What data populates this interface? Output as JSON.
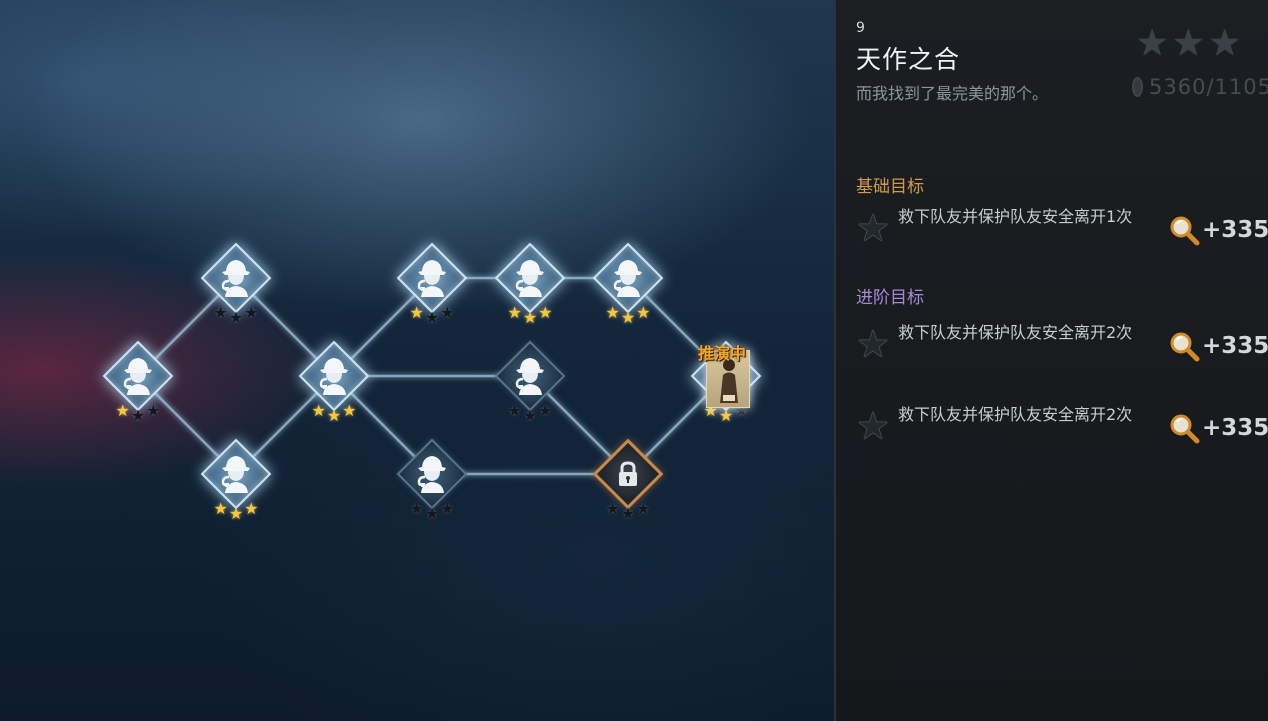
{
  "stage_map": {
    "nodes": [
      {
        "id": "a1",
        "state": "cleared",
        "stars": 1,
        "icon": "detective-icon"
      },
      {
        "id": "a2",
        "state": "cleared",
        "stars": 0,
        "icon": "detective-icon"
      },
      {
        "id": "a3",
        "state": "cleared",
        "stars": 3,
        "icon": "detective-icon"
      },
      {
        "id": "b1",
        "state": "cleared",
        "stars": 2,
        "icon": "detective-icon"
      },
      {
        "id": "c1",
        "state": "cleared",
        "stars": 1,
        "icon": "detective-icon"
      },
      {
        "id": "c2",
        "state": "available",
        "stars": 0,
        "icon": "detective-icon"
      },
      {
        "id": "d1",
        "state": "cleared",
        "stars": 2,
        "icon": "detective-icon"
      },
      {
        "id": "d2",
        "state": "available",
        "stars": 0,
        "icon": "detective-icon"
      },
      {
        "id": "e1",
        "state": "cleared",
        "stars": 3,
        "icon": "detective-icon"
      },
      {
        "id": "e2",
        "state": "locked",
        "stars": 0,
        "icon": "lock-icon"
      },
      {
        "id": "f1",
        "state": "current",
        "stars": 2,
        "icon": "survivor-portrait"
      }
    ],
    "current_badge": "推演中",
    "colors": {
      "star_on": "#f3c740",
      "star_off": "#14181d",
      "node_glow": "#cfe6f6",
      "lock_border": "#c98a4a"
    }
  },
  "panel": {
    "level_number": "9",
    "title": "天作之合",
    "subtitle": "而我找到了最完美的那个。",
    "rating_stars": 3,
    "score_text": "5360/1105",
    "basic_label": "基础目标",
    "advanced_label": "进阶目标",
    "objectives": [
      {
        "text": "救下队友并保护队友安全离开1次",
        "reward": "+335",
        "completed": false
      },
      {
        "text": "救下队友并保护队友安全离开2次",
        "reward": "+335",
        "completed": false
      },
      {
        "text": "救下队友并保护队友安全离开2次",
        "reward": "+335",
        "completed": false
      }
    ],
    "colors": {
      "basic_label": "#d29a4c",
      "advanced_label": "#a78ad6",
      "panel_bg": "#1b1f22"
    }
  }
}
